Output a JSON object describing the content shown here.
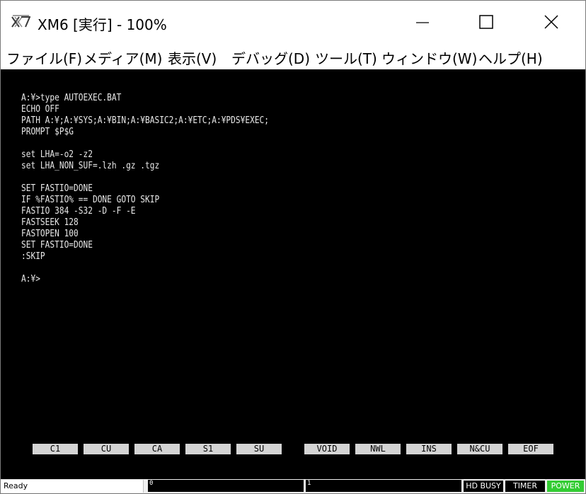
{
  "window": {
    "title": "XM6 [実行] - 100%",
    "controls": [
      "minimize-icon",
      "maximize-icon",
      "close-icon"
    ]
  },
  "menu": {
    "items": [
      "ファイル(F)",
      "メディア(M)",
      "表示(V)",
      "デバッグ(D)",
      "ツール(T)",
      "ウィンドウ(W)",
      "ヘルプ(H)"
    ]
  },
  "terminal": {
    "text": "A:¥>type AUTOEXEC.BAT\nECHO OFF\nPATH A:¥;A:¥SYS;A:¥BIN;A:¥BASIC2;A:¥ETC;A:¥PDS¥EXEC;\nPROMPT $P$G\n\nset LHA=-o2 -z2\nset LHA_NON_SUF=.lzh .gz .tgz\n\nSET FASTIO=DONE\nIF %FASTIO% == DONE GOTO SKIP\nFASTIO 384 -S32 -D -F -E\nFASTSEEK 128\nFASTOPEN 100\nSET FASTIO=DONE\n:SKIP\n\nA:¥>"
  },
  "function_keys": [
    "C1",
    "CU",
    "CA",
    "S1",
    "SU",
    "VOID",
    "NWL",
    "INS",
    "N&CU",
    "EOF"
  ],
  "status": {
    "ready": "Ready",
    "field1": "0",
    "field2": "1",
    "hd_busy": "HD BUSY",
    "timer": "TIMER",
    "power": "POWER"
  },
  "colors": {
    "screen_bg": "#000000",
    "screen_text": "#e8e8e8",
    "fkey_bg": "#d4d4d4",
    "power_on": "#33cc33"
  }
}
